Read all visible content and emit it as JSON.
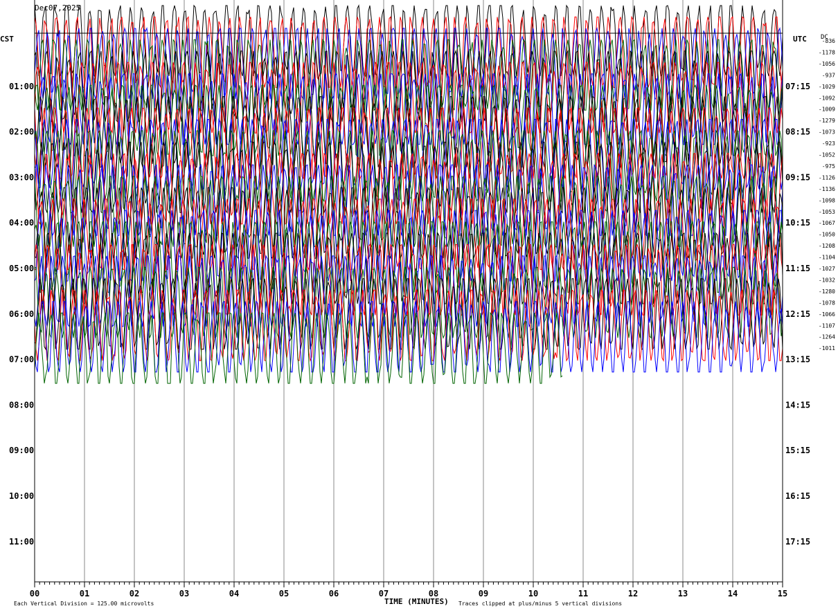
{
  "header": {
    "date": "Dec07,2025",
    "line2": "",
    "line3": ""
  },
  "chart_data": {
    "type": "line",
    "left_timezone": "CST",
    "right_timezone": "UTC",
    "dc_label": "DC",
    "left_hours": [
      "01:00",
      "02:00",
      "03:00",
      "04:00",
      "05:00",
      "06:00",
      "07:00",
      "08:00",
      "09:00",
      "10:00",
      "11:00"
    ],
    "right_hours": [
      "07:15",
      "08:15",
      "09:15",
      "10:15",
      "11:15",
      "12:15",
      "13:15",
      "14:15",
      "15:15",
      "16:15",
      "17:15"
    ],
    "x_ticks": [
      "00",
      "01",
      "02",
      "03",
      "04",
      "05",
      "06",
      "07",
      "08",
      "09",
      "10",
      "11",
      "12",
      "13",
      "14",
      "15"
    ],
    "xlabel": "TIME (MINUTES)",
    "footer_left": "Each Vertical Division =  125.00 microvolts",
    "footer_right": "Traces clipped at plus/minus 5 vertical divisions",
    "dc_offsets": [
      "-836",
      "-1178",
      "-1056",
      "-937",
      "-1029",
      "-1092",
      "-1009",
      "-1279",
      "-1073",
      "-923",
      "-1052",
      "-975",
      "-1126",
      "-1136",
      "-1098",
      "-1053",
      "-1067",
      "-1050",
      "-1208",
      "-1104",
      "-1027",
      "-1032",
      "-1280",
      "-1078",
      "-1066",
      "-1107",
      "-1264",
      "-1011"
    ],
    "trace_colors": [
      "#000000",
      "#ff0000",
      "#0000ff",
      "#006400"
    ],
    "xlim": [
      0,
      15
    ],
    "trace_count": 28,
    "traces_per_hour": 4,
    "clip_divisions": 5
  }
}
